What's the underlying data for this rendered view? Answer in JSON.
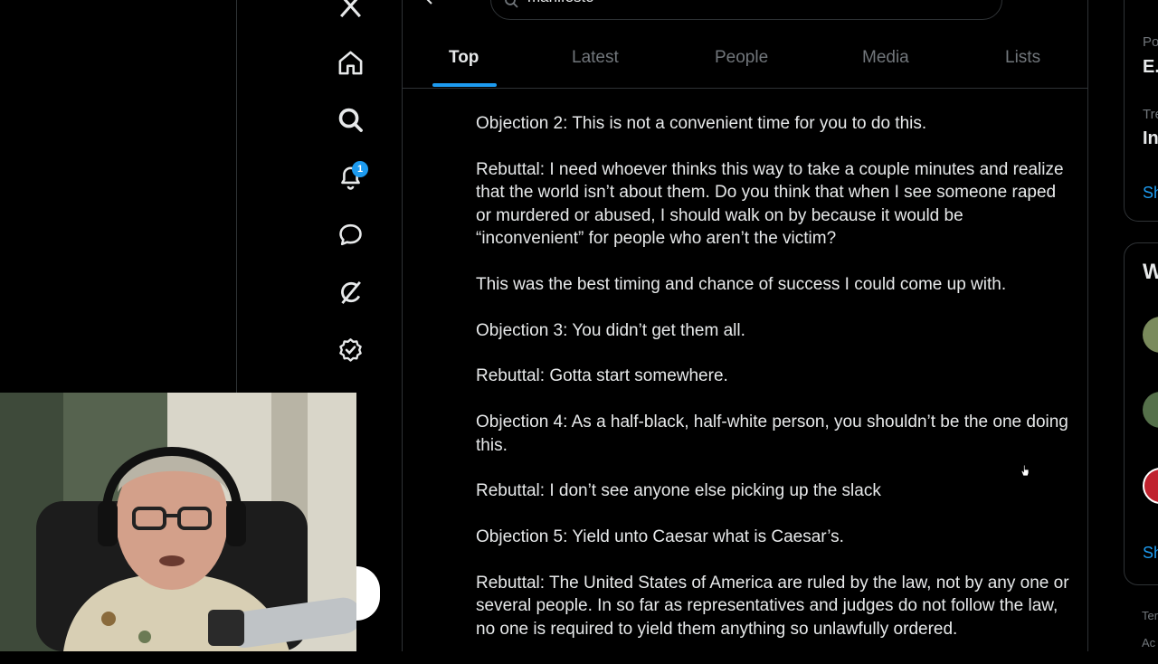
{
  "search": {
    "value": "manifesto"
  },
  "nav": {
    "notifications_count": "1"
  },
  "tabs": [
    {
      "label": "Top",
      "active": true
    },
    {
      "label": "Latest",
      "active": false
    },
    {
      "label": "People",
      "active": false
    },
    {
      "label": "Media",
      "active": false
    },
    {
      "label": "Lists",
      "active": false
    }
  ],
  "post": {
    "paragraphs": [
      "Objection 2: This is not a convenient time for you to do this.",
      "Rebuttal: I need whoever thinks this way to take a couple minutes and realize that the world isn’t about them. Do you think that when I see someone raped or murdered or abused, I should walk on by because it would be “inconvenient” for people who aren’t the victim?",
      "This was the best timing and chance of success I could come up with.",
      "Objection 3: You didn’t get them all.",
      "Rebuttal: Gotta start somewhere.",
      "Objection 4: As a half-black, half-white person, you shouldn’t be the one doing this.",
      "Rebuttal: I don’t see anyone else picking up the slack",
      "Objection 5: Yield unto Caesar what is Caesar’s.",
      "Rebuttal: The United States of America are ruled by the law, not by any one or several people. In so far as representatives and judges do not follow the law, no one is required to yield them anything so unlawfully ordered."
    ]
  },
  "right_sidebar": {
    "card1": {
      "line1": "Po",
      "line2": "E.",
      "line3": "Tre",
      "line4": "In",
      "link": "Sh"
    },
    "card2": {
      "title": "W",
      "link": "Sh"
    },
    "footer1": "Ter",
    "footer2": "Ac"
  },
  "colors": {
    "accent": "#1d9bf0",
    "text": "#e7e9ea",
    "muted": "#71767b",
    "border": "#2f3336"
  }
}
